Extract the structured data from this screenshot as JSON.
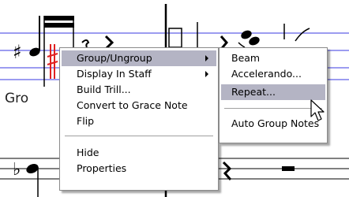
{
  "score": {
    "caption": "Gro"
  },
  "context_menu": {
    "items": [
      {
        "label": "Group/Ungroup",
        "has_submenu": true,
        "highlighted": true
      },
      {
        "label": "Display In Staff",
        "has_submenu": true,
        "highlighted": false
      },
      {
        "label": "Build Trill...",
        "has_submenu": false,
        "highlighted": false
      },
      {
        "label": "Convert to Grace Note",
        "has_submenu": false,
        "highlighted": false
      },
      {
        "label": "Flip",
        "has_submenu": false,
        "highlighted": false
      },
      {
        "label": "Hide",
        "has_submenu": false,
        "highlighted": false
      },
      {
        "label": "Properties",
        "has_submenu": false,
        "highlighted": false
      }
    ]
  },
  "submenu": {
    "items": [
      {
        "label": "Beam",
        "highlighted": false
      },
      {
        "label": "Accelerando...",
        "highlighted": false
      },
      {
        "label": "Repeat...",
        "highlighted": true
      },
      {
        "label": "Auto Group Notes",
        "highlighted": false
      }
    ]
  },
  "colors": {
    "staff_line": "#3a3ae0",
    "accidental": "#e02020",
    "menu_highlight": "#b4b4c4",
    "note": "#000000"
  },
  "icons": {
    "submenu_arrow": "triangle-right",
    "cursor": "arrow-pointer"
  }
}
